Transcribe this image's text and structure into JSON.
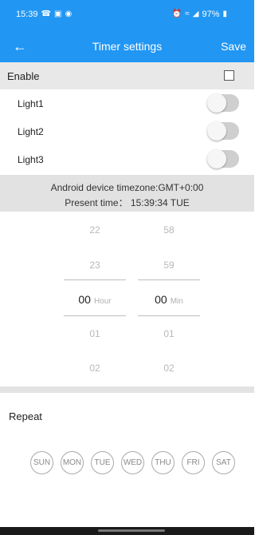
{
  "status_bar": {
    "time": "15:39",
    "left_icons": [
      "phone-icon",
      "image-icon",
      "chat-icon"
    ],
    "right_icons": [
      "alarm-icon",
      "wifi-icon",
      "signal-icon"
    ],
    "battery": "97%"
  },
  "toolbar": {
    "back_icon": "arrow-left-icon",
    "back_glyph": "←",
    "title": "Timer settings",
    "save_label": "Save"
  },
  "enable": {
    "label": "Enable",
    "checked": false
  },
  "lights": [
    {
      "label": "Light1",
      "on": false
    },
    {
      "label": "Light2",
      "on": false
    },
    {
      "label": "Light3",
      "on": false
    }
  ],
  "timezone": {
    "line1": "Android device timezone:GMT+0:00",
    "line2": "Present time： 15:39:34 TUE"
  },
  "picker": {
    "hours": {
      "values": [
        "22",
        "23",
        "00",
        "01",
        "02"
      ],
      "selected": "00",
      "unit": "Hour"
    },
    "minutes": {
      "values": [
        "58",
        "59",
        "00",
        "01",
        "02"
      ],
      "selected": "00",
      "unit": "Min"
    }
  },
  "repeat": {
    "label": "Repeat",
    "days": [
      "SUN",
      "MON",
      "TUE",
      "WED",
      "THU",
      "FRI",
      "SAT"
    ]
  },
  "colors": {
    "accent": "#2196f3",
    "section_bg": "#e8e8e8"
  }
}
